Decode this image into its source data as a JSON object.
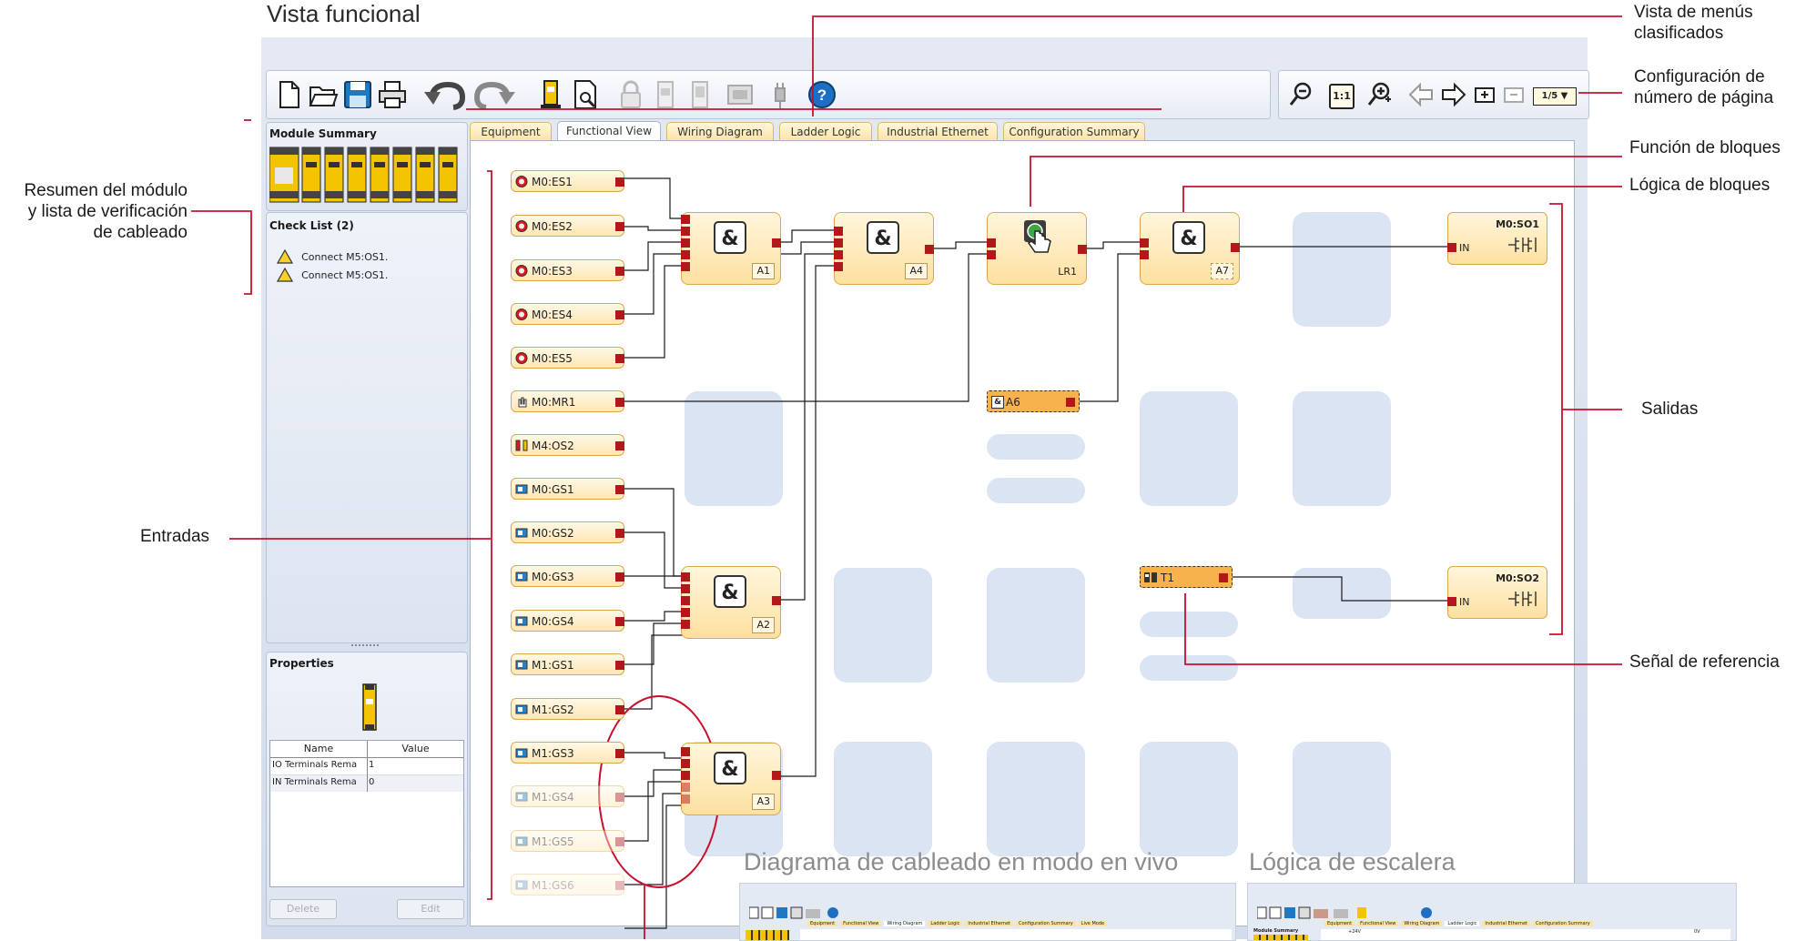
{
  "title": "Vista funcional",
  "annotations": {
    "sorted_menu_view": "Vista de menús\nclasificados",
    "page_number_config": "Configuración de\nnúmero de página",
    "block_function": "Función de bloques",
    "block_logic": "Lógica de bloques",
    "module_summary_checklist": "Resumen del módulo\ny lista de verificación\nde cableado",
    "inputs": "Entradas",
    "outputs": "Salidas",
    "reference_signal": "Señal de referencia",
    "live_wiring": "Diagrama de cableado en modo en vivo",
    "ladder_logic": "Lógica de escalera"
  },
  "left_panel": {
    "module_summary_title": "Module Summary",
    "check_list_title": "Check List (2)",
    "check_items": [
      "Connect M5:OS1.",
      "Connect M5:OS1."
    ],
    "properties_title": "Properties",
    "prop_headers": {
      "name": "Name",
      "value": "Value"
    },
    "props": [
      {
        "name": "IO Terminals Rema",
        "value": "1"
      },
      {
        "name": "IN Terminals Rema",
        "value": "0"
      }
    ],
    "delete_label": "Delete",
    "edit_label": "Edit"
  },
  "tabs": [
    "Equipment",
    "Functional View",
    "Wiring Diagram",
    "Ladder Logic",
    "Industrial Ethernet",
    "Configuration Summary"
  ],
  "active_tab": "Functional View",
  "zoom_toolbar": {
    "fit_label": "1:1",
    "page_label": "1/5 ▼"
  },
  "inputs": [
    "M0:ES1",
    "M0:ES2",
    "M0:ES3",
    "M0:ES4",
    "M0:ES5",
    "M0:MR1",
    "M4:OS2",
    "M0:GS1",
    "M0:GS2",
    "M0:GS3",
    "M0:GS4",
    "M1:GS1",
    "M1:GS2",
    "M1:GS3",
    "M1:GS4",
    "M1:GS5",
    "M1:GS6"
  ],
  "blocks": {
    "a1": {
      "symbol": "&",
      "label": "A1"
    },
    "a4": {
      "symbol": "&",
      "label": "A4"
    },
    "lr1": {
      "label": "LR1"
    },
    "a7": {
      "symbol": "&",
      "label": "A7"
    },
    "a2": {
      "symbol": "&",
      "label": "A2"
    },
    "a3": {
      "symbol": "&",
      "label": "A3"
    },
    "a6": {
      "symbol": "&",
      "label": "A6"
    },
    "t1": {
      "label": "T1"
    }
  },
  "outputs": [
    {
      "name": "M0:SO1",
      "port": "IN"
    },
    {
      "name": "M0:SO2",
      "port": "IN"
    }
  ],
  "mini_tabs_left": [
    "Equipment",
    "Functional View",
    "Wiring Diagram",
    "Ladder Logic",
    "Industrial Ethernet",
    "Configuration Summary",
    "Live Mode"
  ],
  "mini_tabs_right": [
    "Equipment",
    "Functional View",
    "Wiring Diagram",
    "Ladder Logic",
    "Industrial Ethernet",
    "Configuration Summary"
  ],
  "mini_module_summary": "Module Summary",
  "mini_rail_left": "+24V",
  "mini_rail_right": "0V",
  "colors": {
    "accent_red": "#c8102e",
    "port_red": "#b3161b",
    "block_fill": "#fde3a6",
    "placeholder": "#dbe4f2"
  }
}
